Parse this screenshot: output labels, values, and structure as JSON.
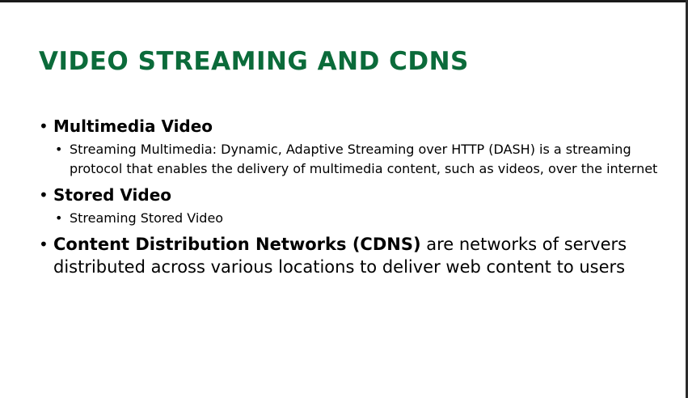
{
  "slide": {
    "title": "VIDEO STREAMING AND CDNS",
    "bullets": [
      {
        "heading": "Multimedia Video",
        "sub": [
          "Streaming Multimedia: Dynamic, Adaptive Streaming over HTTP (DASH) is a streaming protocol that enables the delivery of multimedia content, such as videos, over the internet"
        ]
      },
      {
        "heading": "Stored Video",
        "sub": [
          "Streaming Stored Video"
        ]
      },
      {
        "heading": "Content Distribution Networks (CDNS)",
        "text": " are networks of servers distributed across various locations to deliver web content to users"
      }
    ]
  },
  "bullet_glyph": "•",
  "colors": {
    "title": "#0b6b3a",
    "text": "#000000",
    "background": "#ffffff"
  }
}
